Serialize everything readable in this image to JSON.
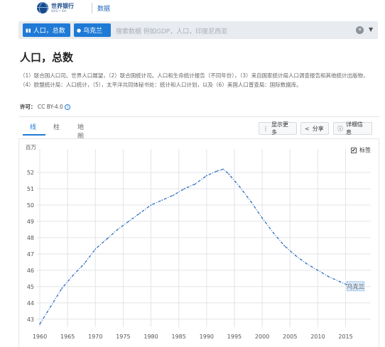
{
  "header": {
    "logo_main": "世界银行",
    "logo_sub": "IBRD • IDA",
    "data_link": "数据"
  },
  "search": {
    "chip_indicator": "人口，总数",
    "chip_country": "乌克兰",
    "placeholder": "搜索数据 例如GDP，人口，印度尼西亚"
  },
  "page": {
    "title": "人口，总数",
    "sources": "（1）联合国人口司。世界人口展望，（2）联合国统计司。人口和生命统计报告（不同年份），（3）来自国家统计局人口调查报告和其他统计出版物，（4）欧盟统计局：人口统计，（5），太平洋共同体秘书处：统计和人口计划，以及（6）美国人口普查局：国际数据库。",
    "license_label": "许可：",
    "license_value": "CC BY-4.0"
  },
  "tabs": [
    "线",
    "柱",
    "地图"
  ],
  "actions": {
    "more": "显示更多",
    "share": "分享",
    "details": "详细信息"
  },
  "chart_controls": {
    "unit": "百万",
    "labels_toggle": "标签",
    "labels_checked": true
  },
  "chart_data": {
    "type": "line",
    "title": "",
    "xlabel": "",
    "ylabel": "百万",
    "grid": true,
    "xlim": [
      1960,
      2018
    ],
    "ylim": [
      42.6,
      53
    ],
    "xticks": [
      1960,
      1965,
      1970,
      1975,
      1980,
      1985,
      1990,
      1995,
      2000,
      2005,
      2010,
      2015
    ],
    "yticks": [
      43,
      44,
      45,
      46,
      47,
      48,
      49,
      50,
      51,
      52
    ],
    "series": [
      {
        "name": "乌克兰",
        "color": "#2f6fbf",
        "x": [
          1960,
          1962,
          1964,
          1966,
          1968,
          1970,
          1972,
          1974,
          1976,
          1978,
          1980,
          1982,
          1984,
          1986,
          1988,
          1990,
          1992,
          1993,
          1994,
          1996,
          1998,
          2000,
          2002,
          2004,
          2006,
          2008,
          2010,
          2012,
          2014,
          2016,
          2018
        ],
        "y": [
          42.7,
          43.8,
          44.9,
          45.7,
          46.4,
          47.3,
          47.9,
          48.5,
          49.0,
          49.5,
          50.0,
          50.3,
          50.6,
          51.0,
          51.3,
          51.8,
          52.1,
          52.2,
          51.9,
          51.1,
          50.2,
          49.2,
          48.3,
          47.5,
          46.9,
          46.4,
          46.0,
          45.6,
          45.3,
          45.0,
          44.8
        ]
      }
    ],
    "series_label": "乌克兰"
  }
}
